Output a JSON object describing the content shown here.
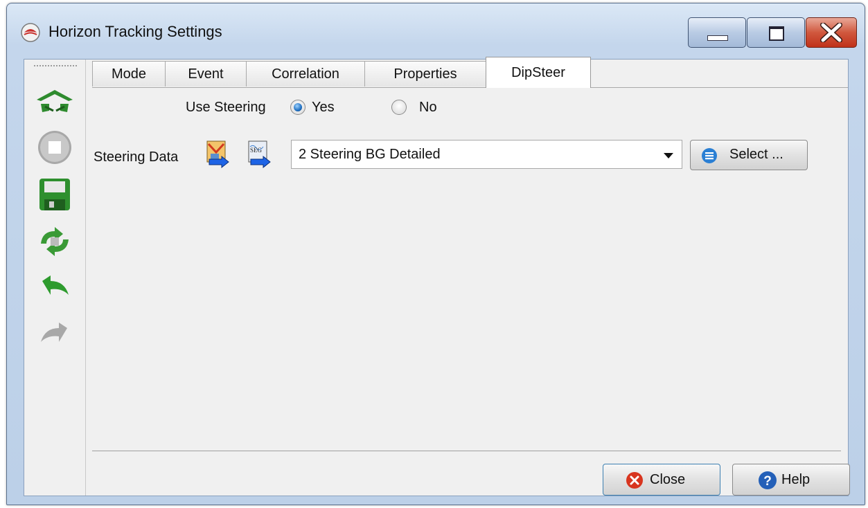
{
  "window": {
    "title": "Horizon Tracking Settings"
  },
  "toolbar": {
    "items": [
      "track-icon",
      "stop-icon",
      "save-icon",
      "retrack-icon",
      "undo-icon",
      "redo-icon"
    ]
  },
  "tabs": [
    {
      "label": "Mode"
    },
    {
      "label": "Event"
    },
    {
      "label": "Correlation"
    },
    {
      "label": "Properties"
    },
    {
      "label": "DipSteer",
      "active": true
    }
  ],
  "dipsteer": {
    "use_steering_label": "Use Steering",
    "yes_label": "Yes",
    "no_label": "No",
    "selected": "Yes",
    "steering_data_label": "Steering Data",
    "steering_value": "2 Steering BG Detailed",
    "select_label": "Select ..."
  },
  "footer": {
    "close_label": "Close",
    "help_label": "Help"
  },
  "colors": {
    "accent": "#2a7fd4",
    "close_icon": "#d8351f",
    "help_icon": "#2460b8",
    "toolbar_green": "#3d9b3a"
  }
}
